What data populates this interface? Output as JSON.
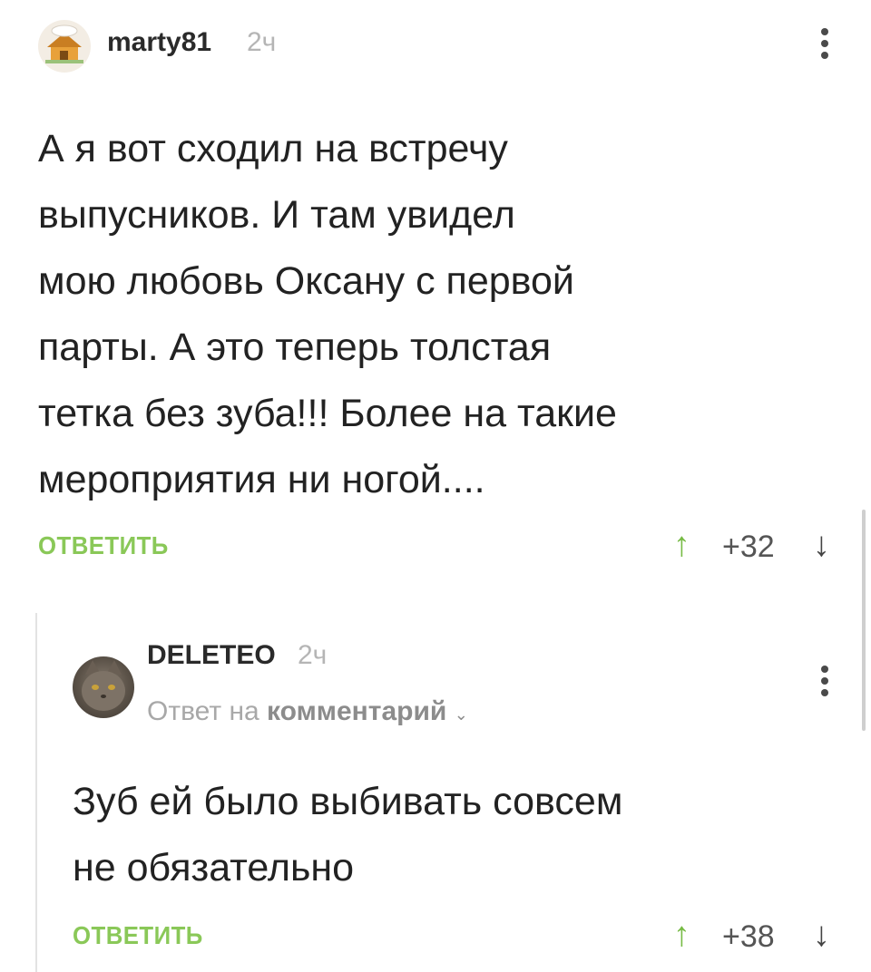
{
  "comments": [
    {
      "username": "marty81",
      "time": "2ч",
      "text_lines": [
        "А я вот сходил на встречу",
        "выпусников. И там увидел",
        "мою любовь Оксану с первой",
        "парты. А это теперь толстая",
        "тетка без зуба!!! Более на такие",
        "мероприятия ни ногой...."
      ],
      "reply_label": "ОТВЕТИТЬ",
      "rating": "+32",
      "upvote_icon": "arrow-up-icon",
      "downvote_icon": "arrow-down-icon"
    },
    {
      "username": "DELETEO",
      "time": "2ч",
      "reply_to_prefix": "Ответ на",
      "reply_to_target": "комментарий",
      "text_lines": [
        "Зуб ей было выбивать совсем",
        "не обязательно"
      ],
      "reply_label": "ОТВЕТИТЬ",
      "rating": "+38",
      "upvote_icon": "arrow-up-icon",
      "downvote_icon": "arrow-down-icon"
    }
  ],
  "colors": {
    "reply_green": "#8ac858",
    "upvote_green": "#77bb45",
    "muted_gray": "#b5b5b5"
  }
}
